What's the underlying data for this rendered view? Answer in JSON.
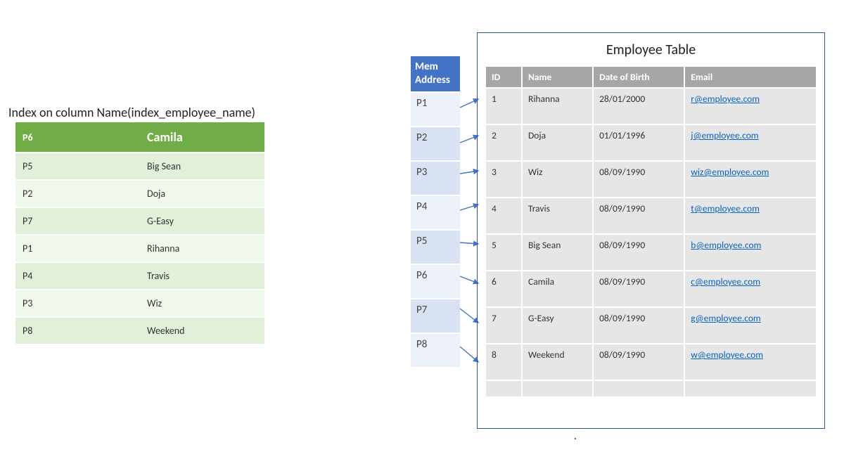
{
  "index": {
    "title": "Index on column Name(index_employee_name)",
    "header": {
      "ptr": "P6",
      "name": "Camila"
    },
    "rows": [
      {
        "ptr": "P5",
        "name": "Big Sean"
      },
      {
        "ptr": "P2",
        "name": "Doja"
      },
      {
        "ptr": "P7",
        "name": "G-Easy"
      },
      {
        "ptr": "P1",
        "name": "Rihanna"
      },
      {
        "ptr": "P4",
        "name": "Travis"
      },
      {
        "ptr": "P3",
        "name": "Wiz"
      },
      {
        "ptr": "P8",
        "name": "Weekend"
      }
    ]
  },
  "mem": {
    "header_line1": "Mem",
    "header_line2": "Address",
    "cells": [
      "P1",
      "P2",
      "P3",
      "P4",
      "P5",
      "P6",
      "P7",
      "P8"
    ]
  },
  "employee": {
    "title": "Employee Table",
    "columns": [
      "ID",
      "Name",
      "Date of Birth",
      "Email"
    ],
    "rows": [
      {
        "id": "1",
        "name": "Rihanna",
        "dob": "28/01/2000",
        "email": "r@employee.com"
      },
      {
        "id": "2",
        "name": "Doja",
        "dob": "01/01/1996",
        "email": "j@employee.com"
      },
      {
        "id": "3",
        "name": "Wiz",
        "dob": "08/09/1990",
        "email": "wiz@employee.com"
      },
      {
        "id": "4",
        "name": "Travis",
        "dob": "08/09/1990",
        "email": "t@employee.com"
      },
      {
        "id": "5",
        "name": "Big Sean",
        "dob": "08/09/1990",
        "email": "b@employee.com"
      },
      {
        "id": "6",
        "name": "Camila",
        "dob": "08/09/1990",
        "email": "c@employee.com"
      },
      {
        "id": "7",
        "name": "G-Easy",
        "dob": "08/09/1990",
        "email": "g@employee.com"
      },
      {
        "id": "8",
        "name": "Weekend",
        "dob": "08/09/1990",
        "email": "w@employee.com"
      }
    ]
  }
}
